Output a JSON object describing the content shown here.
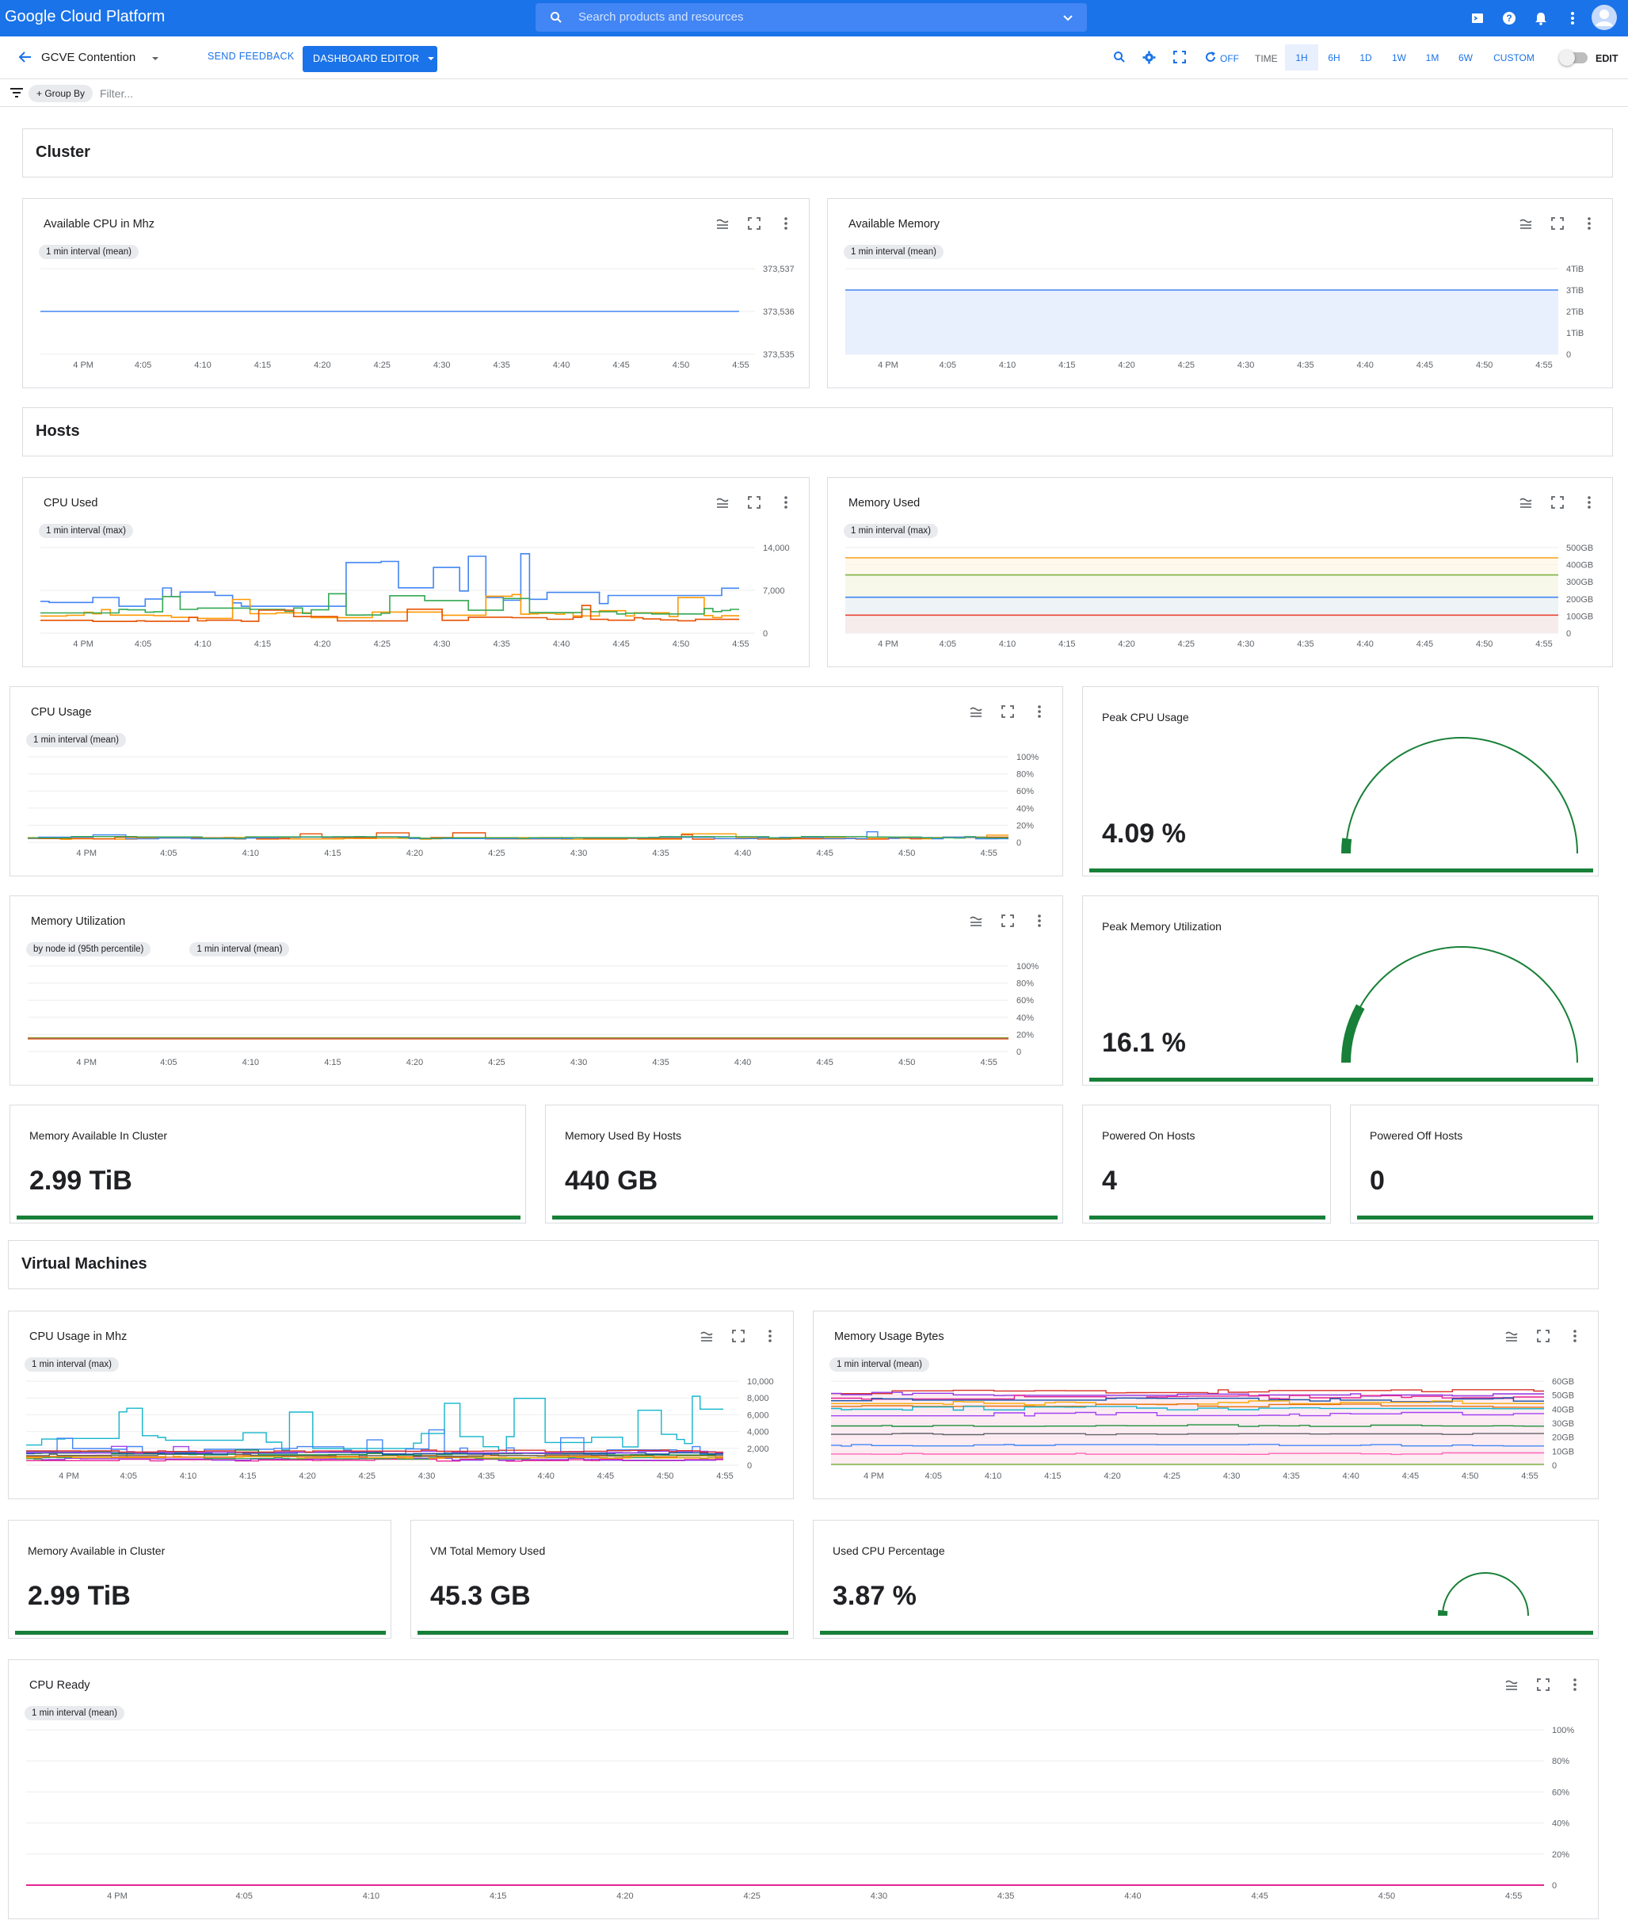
{
  "topbar": {
    "brand": "Google Cloud Platform",
    "search_placeholder": "Search products and resources"
  },
  "toolbar": {
    "dashboard_title": "GCVE Contention",
    "send_feedback": "SEND FEEDBACK",
    "dashboard_editor": "DASHBOARD EDITOR",
    "auto_refresh": "OFF",
    "time_label": "TIME",
    "time_ranges": [
      "1H",
      "6H",
      "1D",
      "1W",
      "1M",
      "6W",
      "CUSTOM"
    ],
    "active_range": "1H",
    "edit_label": "EDIT"
  },
  "filterbar": {
    "group_by": "Group By",
    "filter_placeholder": "Filter..."
  },
  "sections": {
    "cluster": "Cluster",
    "hosts": "Hosts",
    "vms": "Virtual Machines"
  },
  "time_ticks": [
    "4 PM",
    "4:05",
    "4:10",
    "4:15",
    "4:20",
    "4:25",
    "4:30",
    "4:35",
    "4:40",
    "4:45",
    "4:50",
    "4:55"
  ],
  "charts": {
    "available_cpu": {
      "title": "Available CPU in Mhz",
      "chips": [
        "1 min interval (mean)"
      ],
      "yticks": [
        "373,537",
        "373,536",
        "373,535"
      ]
    },
    "available_memory": {
      "title": "Available Memory",
      "chips": [
        "1 min interval (mean)"
      ],
      "yticks": [
        "4TiB",
        "3TiB",
        "2TiB",
        "1TiB",
        "0"
      ]
    },
    "cpu_used": {
      "title": "CPU Used",
      "chips": [
        "1 min interval (max)"
      ],
      "yticks": [
        "14,000",
        "7,000",
        "0"
      ]
    },
    "memory_used": {
      "title": "Memory Used",
      "chips": [
        "1 min interval (max)"
      ],
      "yticks": [
        "500GB",
        "400GB",
        "300GB",
        "200GB",
        "100GB",
        "0"
      ]
    },
    "cpu_usage": {
      "title": "CPU Usage",
      "chips": [
        "1 min interval (mean)"
      ],
      "yticks": [
        "100%",
        "80%",
        "60%",
        "40%",
        "20%",
        "0"
      ]
    },
    "memory_utilization": {
      "title": "Memory Utilization",
      "chips": [
        "by node id (95th percentile)",
        "1 min interval (mean)"
      ],
      "yticks": [
        "100%",
        "80%",
        "60%",
        "40%",
        "20%",
        "0"
      ]
    },
    "vm_cpu_usage": {
      "title": "CPU Usage in Mhz",
      "chips": [
        "1 min interval (max)"
      ],
      "yticks": [
        "10,000",
        "8,000",
        "6,000",
        "4,000",
        "2,000",
        "0"
      ]
    },
    "vm_memory_usage": {
      "title": "Memory Usage Bytes",
      "chips": [
        "1 min interval (mean)"
      ],
      "yticks": [
        "60GB",
        "50GB",
        "40GB",
        "30GB",
        "20GB",
        "10GB",
        "0"
      ]
    },
    "cpu_ready": {
      "title": "CPU Ready",
      "chips": [
        "1 min interval (mean)"
      ],
      "yticks": [
        "100%",
        "80%",
        "60%",
        "40%",
        "20%",
        "0"
      ]
    }
  },
  "gauges": {
    "peak_cpu": {
      "title": "Peak CPU Usage",
      "value": "4.09 %",
      "fraction": 0.0409
    },
    "peak_memory": {
      "title": "Peak Memory Utilization",
      "value": "16.1 %",
      "fraction": 0.161
    },
    "used_cpu_pct": {
      "title": "Used CPU Percentage",
      "value": "3.87 %",
      "fraction": 0.0387
    }
  },
  "scorecards": {
    "mem_available": {
      "title": "Memory Available In Cluster",
      "value": "2.99 TiB"
    },
    "mem_used_hosts": {
      "title": "Memory Used By Hosts",
      "value": "440 GB"
    },
    "powered_on": {
      "title": "Powered On Hosts",
      "value": "4"
    },
    "powered_off": {
      "title": "Powered Off Hosts",
      "value": "0"
    },
    "vm_mem_available": {
      "title": "Memory Available in Cluster",
      "value": "2.99 TiB"
    },
    "vm_total_memory": {
      "title": "VM Total Memory Used",
      "value": "45.3 GB"
    }
  },
  "chart_data": [
    {
      "type": "line",
      "title": "Available CPU in Mhz",
      "ylim": [
        373535,
        373537
      ],
      "series": [
        {
          "values": [
            373536,
            373536,
            373536,
            373536,
            373536,
            373536,
            373536,
            373536,
            373536,
            373536,
            373536,
            373536
          ]
        }
      ]
    },
    {
      "type": "area",
      "title": "Available Memory",
      "ylim": [
        0,
        4
      ],
      "series": [
        {
          "values": [
            3,
            3,
            3,
            3,
            3,
            3,
            3,
            3,
            3,
            3,
            3,
            3
          ]
        }
      ]
    },
    {
      "type": "line",
      "title": "CPU Used",
      "ylim": [
        0,
        14000
      ],
      "series_count": 4
    },
    {
      "type": "area",
      "title": "Memory Used",
      "ylim": [
        0,
        500
      ],
      "series": [
        {
          "values": [
            440
          ]
        },
        {
          "values": [
            340
          ]
        },
        {
          "values": [
            210
          ]
        },
        {
          "values": [
            105
          ]
        }
      ]
    },
    {
      "type": "line",
      "title": "CPU Usage",
      "ylim": [
        0,
        100
      ]
    },
    {
      "type": "line",
      "title": "Memory Utilization",
      "ylim": [
        0,
        100
      ]
    },
    {
      "type": "line",
      "title": "CPU Usage in Mhz",
      "ylim": [
        0,
        10000
      ]
    },
    {
      "type": "area",
      "title": "Memory Usage Bytes",
      "ylim": [
        0,
        60
      ]
    },
    {
      "type": "line",
      "title": "CPU Ready",
      "ylim": [
        0,
        100
      ],
      "series": [
        {
          "values": [
            0,
            0,
            0,
            0,
            0,
            0,
            0,
            0,
            0,
            0,
            0,
            0
          ]
        }
      ]
    }
  ],
  "colors": {
    "primary": "#1a73e8",
    "green": "#188038",
    "blue_line": "#4285f4",
    "orange": "#ff9800"
  }
}
